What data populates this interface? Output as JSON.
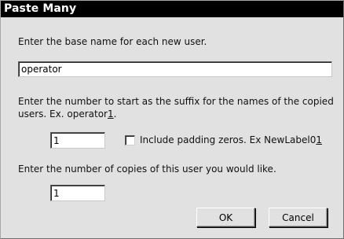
{
  "dialog": {
    "title": "Paste Many",
    "base_name_prompt": "Enter the base name for each new user.",
    "base_name_value": "operator",
    "suffix_prompt_line1": "Enter the number to start as the suffix for the names of the copied",
    "suffix_prompt_line2_prefix": "users. Ex. operator",
    "suffix_prompt_line2_digit": "1",
    "suffix_prompt_line2_end": ".",
    "suffix_value": "1",
    "padding_label_prefix": "Include padding zeros.  Ex NewLabel0",
    "padding_label_digit": "1",
    "padding_checked": false,
    "copies_prompt": "Enter the number of copies of this user you would like.",
    "copies_value": "1",
    "ok_label": "OK",
    "cancel_label": "Cancel"
  }
}
